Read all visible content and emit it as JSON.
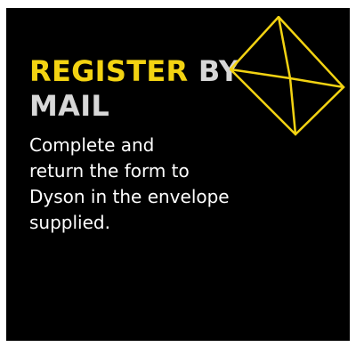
{
  "heading": {
    "accent_word": "REGISTER",
    "rest_line1": "BY",
    "rest_line2": "MAIL"
  },
  "body": {
    "line1": "Complete and",
    "line2": "return the form to",
    "line3": "Dyson in the envelope",
    "line4": "supplied."
  },
  "icons": {
    "envelope": "envelope-icon"
  },
  "colors": {
    "background": "#000000",
    "accent": "#f3d312",
    "heading": "#d7d7d7",
    "text": "#ffffff"
  }
}
